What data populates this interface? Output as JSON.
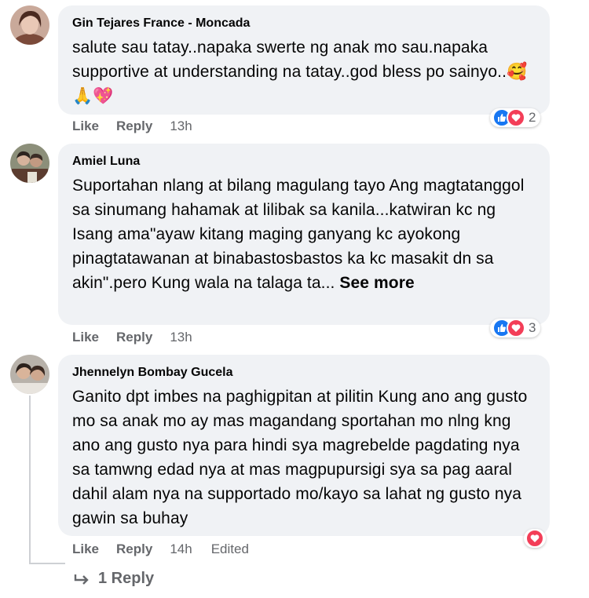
{
  "comments": [
    {
      "author": "Gin Tejares France - Moncada",
      "text": "salute sau tatay..napaka swerte ng anak mo sau.napaka supportive at understanding na tatay..god bless po sainyo..",
      "emoji": "🥰🙏💖",
      "like_label": "Like",
      "reply_label": "Reply",
      "time": "13h",
      "reaction_count": "2"
    },
    {
      "author": "Amiel Luna",
      "text": "Suportahan nlang at bilang magulang tayo Ang magtatanggol sa sinumang hahamak at lilibak sa kanila...katwiran kc ng Isang ama\"ayaw kitang maging ganyang kc ayokong pinagtatawanan at binabastosbastos ka kc masakit dn sa akin\".pero Kung wala na talaga ta...",
      "see_more": "See more",
      "like_label": "Like",
      "reply_label": "Reply",
      "time": "13h",
      "reaction_count": "3"
    },
    {
      "author": "Jhennelyn Bombay Gucela",
      "text": "Ganito dpt imbes na paghigpitan at pilitin Kung ano ang gusto mo sa anak mo ay mas magandang sportahan mo nlng kng ano ang gusto nya para hindi sya magrebelde pagdating nya sa tamwng edad nya at mas magpupursigi sya sa pag aaral dahil alam nya na supportado mo/kayo sa lahat ng gusto nya gawin sa buhay",
      "like_label": "Like",
      "reply_label": "Reply",
      "time": "14h",
      "edited": "Edited"
    }
  ],
  "replies_link": "1 Reply",
  "colors": {
    "bubble": "#f0f2f5",
    "meta": "#65676b",
    "like_blue": "#1877f2",
    "love_red": "#f33e58"
  },
  "icons": [
    "like-reaction-icon",
    "love-reaction-icon",
    "reply-arrow-icon"
  ]
}
